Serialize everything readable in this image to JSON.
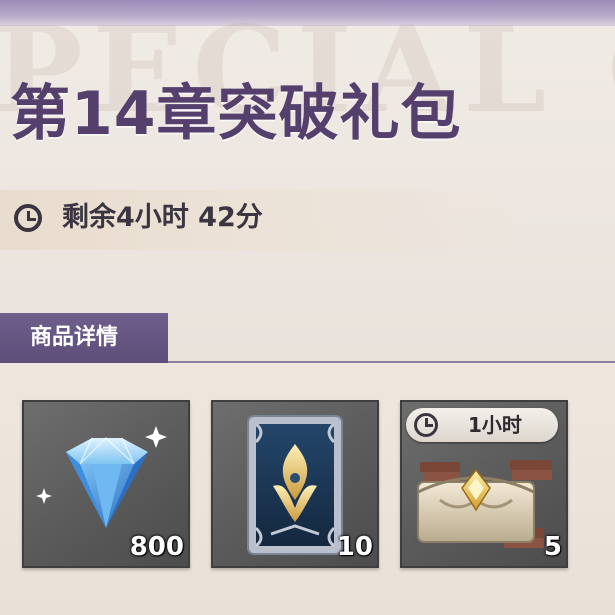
{
  "header": {
    "watermark": "PECIAL O",
    "title": "第14章突破礼包"
  },
  "timer": {
    "icon": "clock-icon",
    "remaining": "剩余4小时 42分"
  },
  "section": {
    "label": "商品详情"
  },
  "items": [
    {
      "name": "diamond",
      "icon": "blue-diamond-icon",
      "quantity": "800"
    },
    {
      "name": "card",
      "icon": "blue-card-icon",
      "quantity": "10"
    },
    {
      "name": "chest",
      "icon": "book-chest-icon",
      "quantity": "5",
      "badge": "1小时"
    }
  ],
  "colors": {
    "title": "#55406d",
    "section_tab": "#6f5f8c",
    "card_bg": "#5f5f5f"
  }
}
